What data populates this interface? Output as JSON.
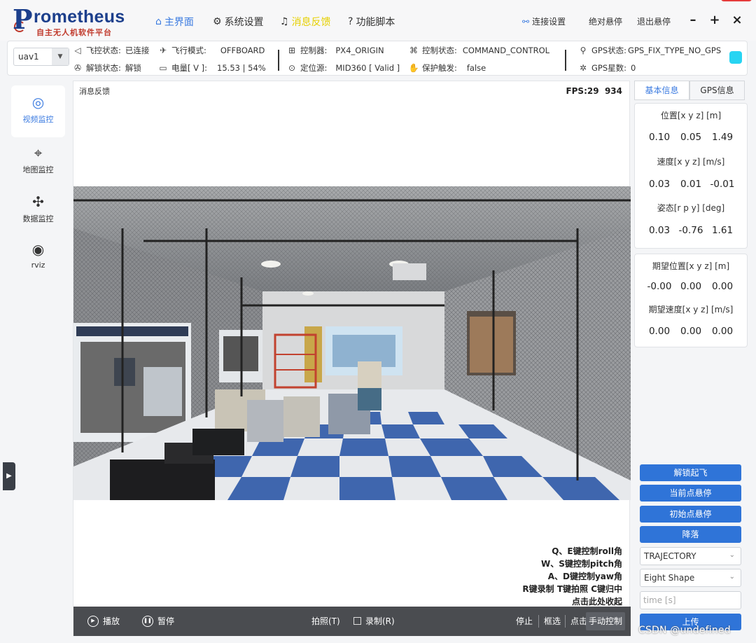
{
  "app": {
    "logo_initial": "P",
    "logo_rest": "rometheus",
    "logo_subtitle": "自主无人机软件平台"
  },
  "nav": {
    "home": "主界面",
    "settings": "系统设置",
    "messages": "消息反馈",
    "scripts": "功能脚本",
    "active": "home",
    "messages_color": "#e6d000"
  },
  "header_buttons": {
    "connect": "连接设置",
    "absolute_hover": "绝对悬停",
    "exit_hover": "退出悬停",
    "minimize": "–",
    "maximize": "+",
    "close": "×"
  },
  "status": {
    "uav": "uav1",
    "flight_ctrl_label": "飞控状态:",
    "flight_ctrl_value": "已连接",
    "flight_mode_label": "飞行模式:",
    "flight_mode_value": "OFFBOARD",
    "controller_label": "控制器:",
    "controller_value": "PX4_ORIGIN",
    "control_state_label": "控制状态:",
    "control_state_value": "COMMAND_CONTROL",
    "gps_state_label": "GPS状态:",
    "gps_state_value": "GPS_FIX_TYPE_NO_GPS",
    "unlock_label": "解锁状态:",
    "unlock_value": "解锁",
    "battery_label": "电量[ V ]:",
    "battery_value": "15.53 | 54%",
    "location_label": "定位源:",
    "location_value": "MID360 [ Valid ]",
    "protect_label": "保护触发:",
    "protect_value": "false",
    "gps_sats_label": "GPS星数:",
    "gps_sats_value": "0",
    "indicator_color": "#27d4f2"
  },
  "sidebar": {
    "items": [
      {
        "label": "视频监控",
        "icon": "camera-icon",
        "active": true
      },
      {
        "label": "地图监控",
        "icon": "map-pin-icon",
        "active": false
      },
      {
        "label": "数据监控",
        "icon": "drone-icon",
        "active": false
      },
      {
        "label": "rviz",
        "icon": "rviz-icon",
        "active": false
      }
    ]
  },
  "video": {
    "title": "消息反馈",
    "fps_label": "FPS:29",
    "fps_extra": "934",
    "hints": [
      "Q、E键控制roll角",
      "W、S键控制pitch角",
      "A、D键控制yaw角",
      "R键录制 T键拍照 C键归中",
      "点击此处收起"
    ],
    "controls": {
      "play": "播放",
      "pause": "暂停",
      "photo": "拍照(T)",
      "record": "录制(R)",
      "stop": "停止",
      "box_select": "框选",
      "click": "点击",
      "manual": "手动控制"
    }
  },
  "right_panel": {
    "tabs": [
      "基本信息",
      "GPS信息"
    ],
    "active_tab": 0,
    "position_title": "位置[x y z] [m]",
    "position": [
      "0.10",
      "0.05",
      "1.49"
    ],
    "velocity_title": "速度[x y z] [m/s]",
    "velocity": [
      "0.03",
      "0.01",
      "-0.01"
    ],
    "attitude_title": "姿态[r p y] [deg]",
    "attitude": [
      "0.03",
      "-0.76",
      "1.61"
    ],
    "desired_pos_title": "期望位置[x y z] [m]",
    "desired_pos": [
      "-0.00",
      "0.00",
      "0.00"
    ],
    "desired_vel_title": "期望速度[x y z] [m/s]",
    "desired_vel": [
      "0.00",
      "0.00",
      "0.00"
    ],
    "actions": [
      "解锁起飞",
      "当前点悬停",
      "初始点悬停",
      "降落"
    ],
    "mode_select": "TRAJECTORY",
    "shape_select": "Eight Shape",
    "time_placeholder": "time [s]",
    "upload": "上传",
    "accent": "#2f74d8"
  },
  "watermark": "CSDN @undefined"
}
